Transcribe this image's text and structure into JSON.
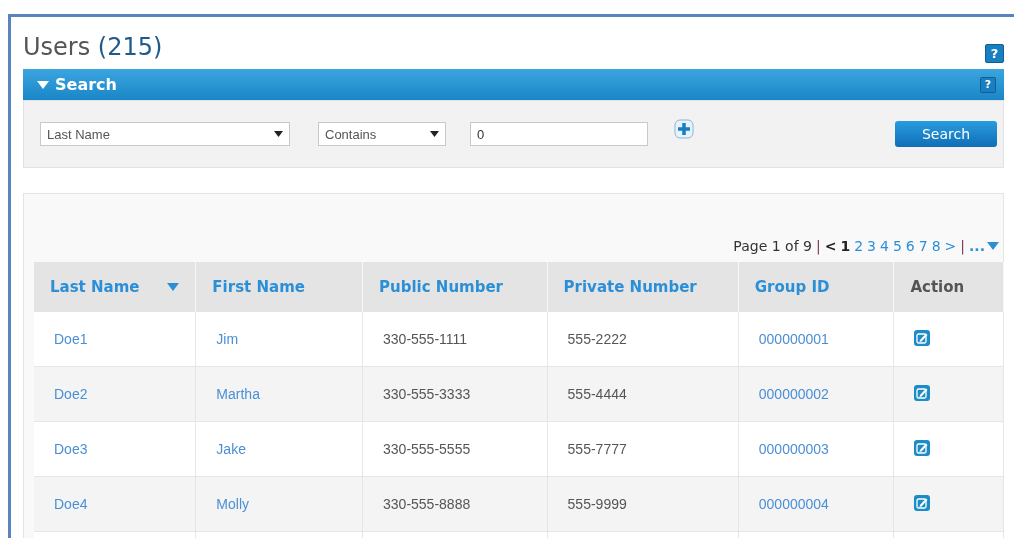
{
  "header": {
    "title": "Users",
    "count": "(215)",
    "help": "?"
  },
  "search": {
    "title": "Search",
    "help": "?",
    "expanded": true,
    "field_select": "Last Name",
    "operator_select": "Contains",
    "value": "0",
    "button": "Search"
  },
  "pager": {
    "label": "Page 1 of 9",
    "separators": [
      "|",
      "|"
    ],
    "prev": "<",
    "next": ">",
    "more": "...",
    "pages": [
      {
        "label": "1",
        "selected": true
      },
      {
        "label": "2",
        "selected": false
      },
      {
        "label": "3",
        "selected": false
      },
      {
        "label": "4",
        "selected": false
      },
      {
        "label": "5",
        "selected": false
      },
      {
        "label": "6",
        "selected": false
      },
      {
        "label": "7",
        "selected": false
      },
      {
        "label": "8",
        "selected": false
      }
    ]
  },
  "table": {
    "columns": [
      {
        "label": "Last Name",
        "kind": "link",
        "sorted": true
      },
      {
        "label": "First Name",
        "kind": "link",
        "sorted": false
      },
      {
        "label": "Public Number",
        "kind": "text",
        "sorted": false
      },
      {
        "label": "Private Number",
        "kind": "text",
        "sorted": false
      },
      {
        "label": "Group ID",
        "kind": "link",
        "sorted": false
      },
      {
        "label": "Action",
        "kind": "action",
        "sorted": false
      }
    ],
    "rows": [
      [
        "Doe1",
        "Jim",
        "330-555-1111",
        "555-2222",
        "000000001"
      ],
      [
        "Doe2",
        "Martha",
        "330-555-3333",
        "555-4444",
        "000000002"
      ],
      [
        "Doe3",
        "Jake",
        "330-555-5555",
        "555-7777",
        "000000003"
      ],
      [
        "Doe4",
        "Molly",
        "330-555-8888",
        "555-9999",
        "000000004"
      ]
    ]
  }
}
